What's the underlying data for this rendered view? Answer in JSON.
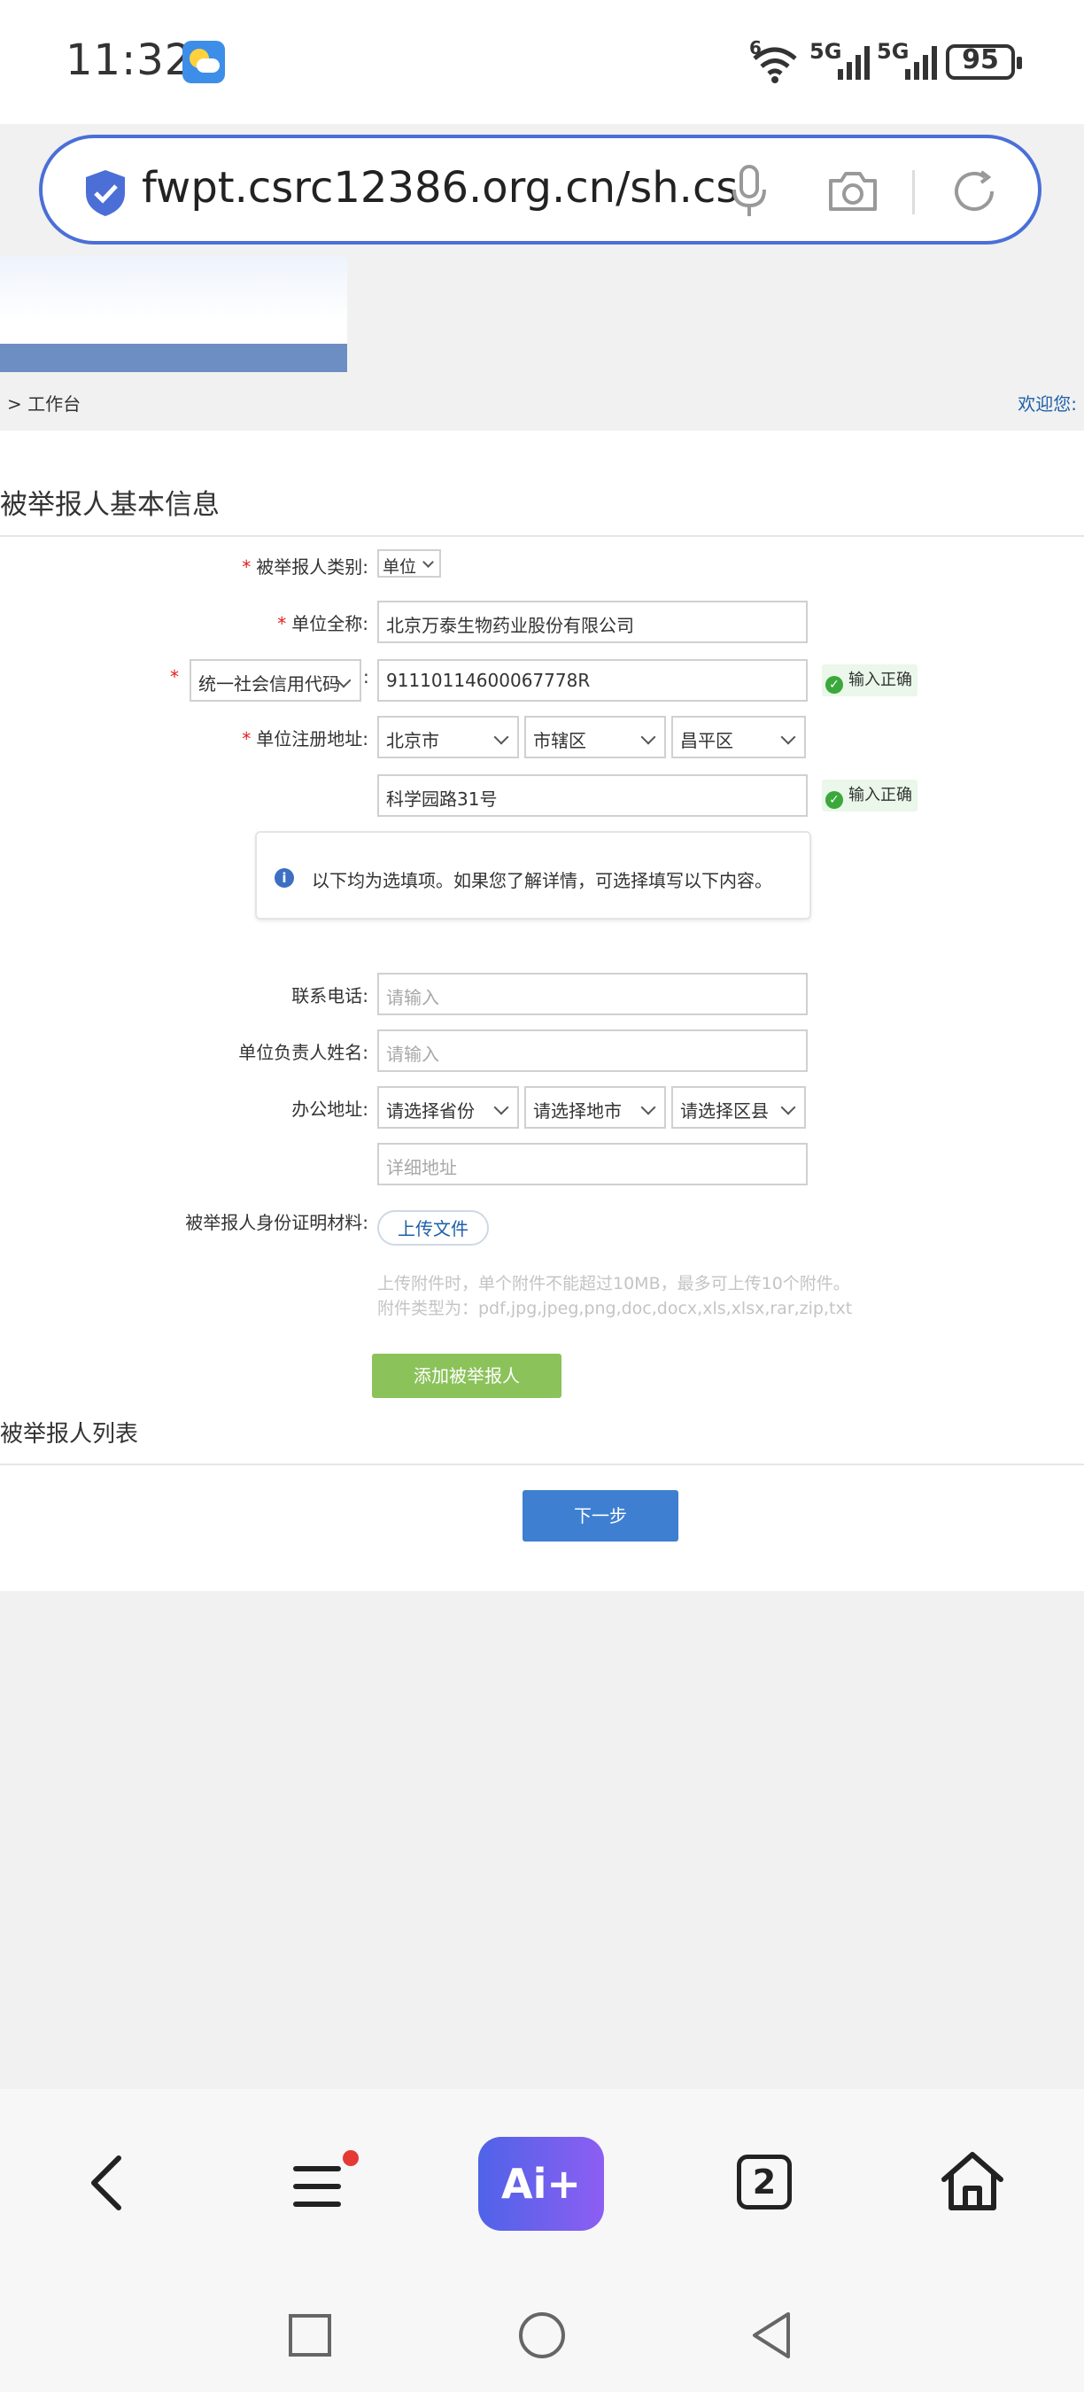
{
  "status_bar": {
    "time": "11:32",
    "network1": "5G",
    "network2": "5G",
    "wifi_badge": "6",
    "battery": "95"
  },
  "browser": {
    "url": "fwpt.csrc12386.org.cn/sh.cs",
    "accent_color": "#4b6fd7"
  },
  "header": {
    "breadcrumb": "> 工作台",
    "welcome": "欢迎您:"
  },
  "form": {
    "section_title": "被举报人基本信息",
    "type_label": "被举报人类别:",
    "type_value": "单位",
    "name_label": "单位全称:",
    "name_value": "北京万泰生物药业股份有限公司",
    "id_type_value": "统一社会信用代码",
    "id_value": "91110114600067778R",
    "valid_text": "输入正确",
    "reg_addr_label": "单位注册地址:",
    "reg_province": "北京市",
    "reg_city": "市辖区",
    "reg_district": "昌平区",
    "reg_detail": "科学园路31号",
    "notice": "以下均为选填项。如果您了解详情，可选择填写以下内容。",
    "phone_label": "联系电话:",
    "phone_placeholder": "请输入",
    "leader_label": "单位负责人姓名:",
    "leader_placeholder": "请输入",
    "office_label": "办公地址:",
    "office_province": "请选择省份",
    "office_city": "请选择地市",
    "office_district": "请选择区县",
    "office_detail_placeholder": "详细地址",
    "material_label": "被举报人身份证明材料:",
    "upload_label": "上传文件",
    "hint1": "上传附件时，单个附件不能超过10MB，最多可上传10个附件。",
    "hint2": "附件类型为：pdf,jpg,jpeg,png,doc,docx,xls,xlsx,rar,zip,txt",
    "add_button": "添加被举报人",
    "list_title": "被举报人列表",
    "next_button": "下一步"
  },
  "bottom_nav": {
    "ai_label": "Ai+",
    "tab_count": "2"
  },
  "icons": [
    "back-icon",
    "menu-icon",
    "tabs-icon",
    "home-icon",
    "mic-icon",
    "camera-icon",
    "refresh-icon",
    "shield-icon"
  ]
}
